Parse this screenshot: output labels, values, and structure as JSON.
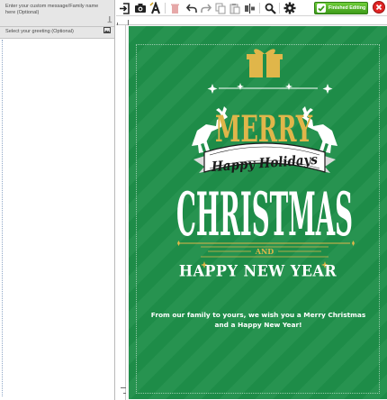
{
  "left_panel": {
    "message_field": {
      "label": "Enter your custom message/Family name here (Optional)",
      "icon": "text-cursor-icon"
    },
    "greeting_field": {
      "label": "Select your greeting (Optional)",
      "icon": "image-icon"
    }
  },
  "toolbar": {
    "finished_label": "Finished Editing",
    "icons": [
      "exit-icon",
      "camera-icon",
      "text-style-icon",
      "delete-icon",
      "undo-icon",
      "redo-icon",
      "copy-icon",
      "paste-icon",
      "align-icon",
      "search-icon",
      "settings-icon",
      "close-icon"
    ],
    "accent": "#3f9c1a",
    "close_color": "#e02424"
  },
  "card": {
    "background": "#1f8f4a",
    "gold": "#e0b64a",
    "merry": "MERRY",
    "ribbon": "Happy Holidays",
    "christmas": "CHRISTMAS",
    "and": "AND",
    "new_year": "HAPPY NEW YEAR",
    "message": "From our family to yours, we wish you a Merry Christmas and a Happy New Year!"
  }
}
